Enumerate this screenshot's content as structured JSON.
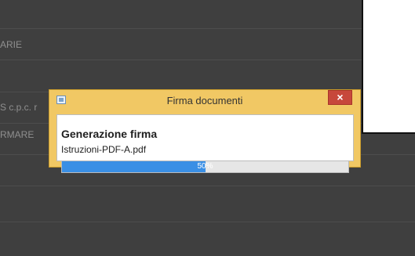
{
  "background": {
    "rows": [
      {
        "text": ""
      },
      {
        "text": "ARIE"
      },
      {
        "text": ""
      },
      {
        "text": "S c.p.c. r"
      },
      {
        "text": "RMARE"
      },
      {
        "text": ""
      },
      {
        "text": ""
      },
      {
        "text": ""
      }
    ]
  },
  "dialog": {
    "title": "Firma documenti",
    "close_label": "×",
    "heading": "Generazione firma",
    "filename": "Istruzioni-PDF-A.pdf",
    "progress_text": "50%",
    "progress_fraction": 0.5
  },
  "colors": {
    "dialog_frame": "#f1c864",
    "close_button": "#c7483b",
    "progress_fill": "#3a8fe5",
    "overlay": "#3f3f3f"
  }
}
